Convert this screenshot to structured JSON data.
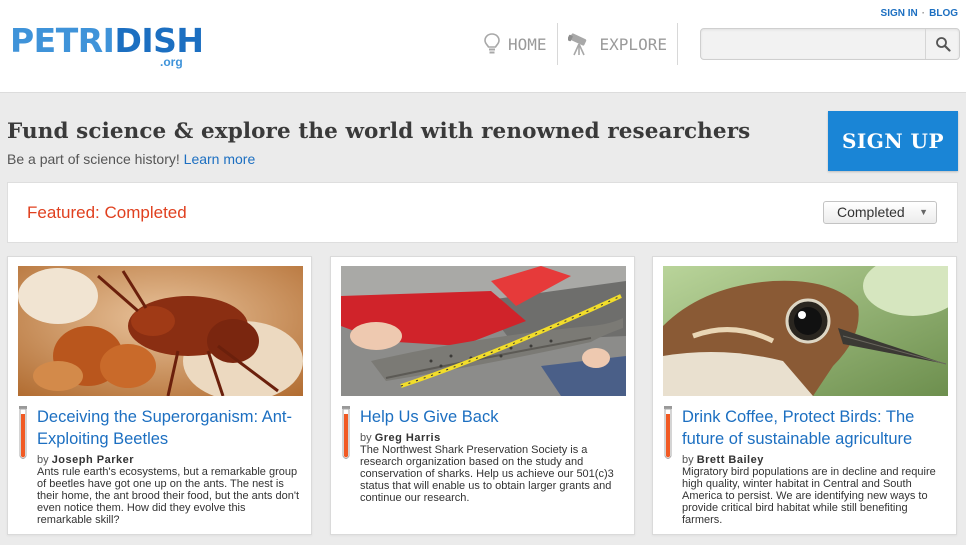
{
  "brand": {
    "part1": "PETRI",
    "part2": "DISH",
    "tld": ".org"
  },
  "toplinks": {
    "signin": "SIGN IN",
    "sep": "·",
    "blog": "BLOG"
  },
  "nav": {
    "home": "HOME",
    "explore": "EXPLORE"
  },
  "search": {
    "value": "",
    "placeholder": ""
  },
  "hero": {
    "title": "Fund science & explore the world with renowned researchers",
    "subtitle": "Be a part of science history!",
    "learn_more": "Learn more",
    "signup": "SIGN UP"
  },
  "featured": {
    "label": "Featured: Completed",
    "filter_value": "Completed"
  },
  "cards": [
    {
      "title": "Deceiving the Superorganism: Ant-Exploiting Beetles",
      "by": "by",
      "author": "Joseph Parker",
      "desc": "Ants rule earth's ecosystems, but a remarkable group of beetles have got one up on the ants. The nest is their home, the ant brood their food, but the ants don't even notice them. How did they evolve this remarkable skill?",
      "image": "beetle-photo"
    },
    {
      "title": "Help Us Give Back",
      "by": "by",
      "author": "Greg Harris",
      "desc": "The Northwest Shark Preservation Society is a research organization based on the study and conservation of sharks. Help us achieve our 501(c)3 status that will enable us to obtain larger grants and continue our research.",
      "image": "shark-measuring-photo"
    },
    {
      "title": "Drink Coffee, Protect Birds: The future of sustainable agriculture",
      "by": "by",
      "author": "Brett Bailey",
      "desc": "Migratory bird populations are in decline and require high quality, winter habitat in Central and South America to persist. We are identifying new ways to provide critical bird habitat while still benefiting farmers.",
      "image": "bird-photo"
    }
  ],
  "colors": {
    "brand_light": "#3f93d9",
    "brand_dark": "#1c6fc1",
    "accent_red": "#e0401f",
    "signup_blue": "#1a85d6"
  },
  "icons": {
    "home": "lightbulb-icon",
    "explore": "telescope-icon",
    "search": "search-icon",
    "card_marker": "test-tube-icon"
  }
}
